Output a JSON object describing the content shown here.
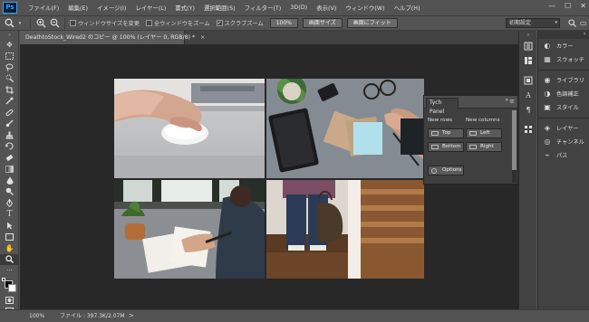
{
  "app": {
    "logo": "Ps"
  },
  "menu": [
    "ファイル(F)",
    "編集(E)",
    "イメージ(I)",
    "レイヤー(L)",
    "書式(Y)",
    "選択範囲(S)",
    "フィルター(T)",
    "3D(D)",
    "表示(V)",
    "ウィンドウ(W)",
    "ヘルプ(H)"
  ],
  "window_controls": {
    "minimize": "—",
    "maximize": "☐",
    "close": "✕"
  },
  "options_bar": {
    "chk_resize": {
      "label": "ウィンドウサイズを変更",
      "checked": false
    },
    "chk_all_windows": {
      "label": "全ウィンドウをズーム",
      "checked": false
    },
    "chk_scrubby": {
      "label": "スクラブズーム",
      "checked": true
    },
    "btn_100": "100%",
    "btn_print_size": "画面サイズ",
    "btn_fit_screen": "画面にフィット",
    "workspace": "初期設定"
  },
  "document_tab": {
    "title": "DeathtoStock_Wired2 のコピー @ 100% (レイヤー 0, RGB/8) *",
    "close": "×"
  },
  "right_panels": {
    "group1": [
      {
        "icon": "color-icon",
        "label": "カラー"
      },
      {
        "icon": "swatches-icon",
        "label": "スウォッチ"
      }
    ],
    "group2": [
      {
        "icon": "libraries-icon",
        "label": "ライブラリ"
      },
      {
        "icon": "adjustments-icon",
        "label": "色調補正"
      },
      {
        "icon": "styles-icon",
        "label": "スタイル"
      }
    ],
    "group3": [
      {
        "icon": "layers-icon",
        "label": "レイヤー"
      },
      {
        "icon": "channels-icon",
        "label": "チャンネル"
      },
      {
        "icon": "paths-icon",
        "label": "パス"
      }
    ]
  },
  "tych_panel": {
    "tab": "Tych Panel",
    "new_rows": "New rows",
    "new_columns": "New columns",
    "top": "Top",
    "bottom": "Bottom",
    "left": "Left",
    "right": "Right",
    "options": "Options"
  },
  "status_bar": {
    "zoom": "100%",
    "info": "ファイル : 397.3K/2.07M",
    "arrow": ">"
  }
}
